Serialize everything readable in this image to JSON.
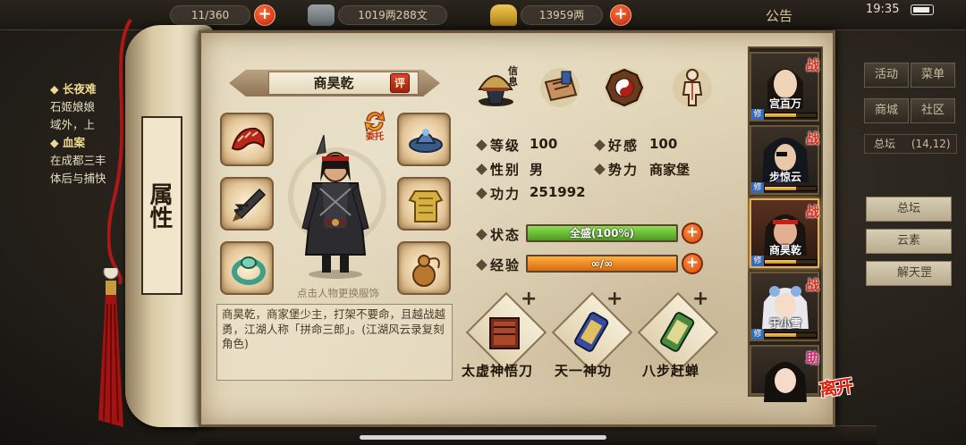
{
  "status_bar": {
    "clock": "19:35",
    "battery": "full"
  },
  "top_bar": {
    "party_count": "11/360",
    "silver": "1019两288文",
    "gold": "13959两",
    "notice": "公告"
  },
  "quest_panel": {
    "items": [
      {
        "title": "长夜难",
        "lines": [
          "石姬娘娘",
          "域外，上"
        ]
      },
      {
        "title": "血案",
        "lines": [
          "在成都三丰",
          "体后与捕快"
        ]
      }
    ]
  },
  "right_menu": {
    "buttons": [
      "活动",
      "菜单",
      "商城",
      "社区"
    ],
    "location": "总坛",
    "coords": "(14,12)",
    "list": [
      "总坛",
      "云素",
      "解天罡"
    ]
  },
  "scroll": {
    "title": "属性"
  },
  "character": {
    "name": "商昊乾",
    "rate_label": "评",
    "delegate_label": "委托",
    "change_outfit_hint": "点击人物更换服饰",
    "description": "商昊乾，商家堡少主，打架不要命，且越战越勇，江湖人称「拼命三郎」。(江湖风云录复刻角色)"
  },
  "tabs": [
    {
      "name": "info",
      "label": "信息",
      "icon": "bell-hat-icon"
    },
    {
      "name": "inventory",
      "icon": "scroll-bag-icon"
    },
    {
      "name": "bagua",
      "icon": "bagua-icon"
    },
    {
      "name": "meridian",
      "icon": "body-meridian-icon"
    }
  ],
  "stats": {
    "level_label": "等级",
    "level": "100",
    "favor_label": "好感",
    "favor": "100",
    "gender_label": "性别",
    "gender": "男",
    "faction_label": "势力",
    "faction": "商家堡",
    "power_label": "功力",
    "power": "251992"
  },
  "bars": {
    "status_label": "状态",
    "status_text": "全盛(100%)",
    "status_pct": 100,
    "exp_label": "经验",
    "exp_text": "∞/∞",
    "exp_pct": 100
  },
  "skills": [
    {
      "name": "太虚神悟刀",
      "plus": "+"
    },
    {
      "name": "天一神功",
      "plus": "+"
    },
    {
      "name": "八步赶蝉",
      "plus": "+"
    }
  ],
  "roster": [
    {
      "name": "宫百万",
      "tag": "战",
      "lv": "修",
      "exp": 0.6
    },
    {
      "name": "步惊云",
      "tag": "战",
      "lv": "修",
      "exp": 0.6
    },
    {
      "name": "商昊乾",
      "tag": "战",
      "lv": "修",
      "exp": 0.6,
      "selected": true
    },
    {
      "name": "于小雪",
      "tag": "战",
      "lv": "修",
      "exp": 0.6
    },
    {
      "name": "",
      "tag": "助",
      "lv": "",
      "exp": 0
    }
  ],
  "leave_label": "离开",
  "colors": {
    "status_bar": "#6cc23a",
    "exp_bar": "#e8861c",
    "accent_red": "#e0200c",
    "parchment": "#e2d6b8"
  }
}
